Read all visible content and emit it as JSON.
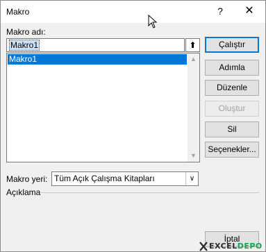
{
  "window": {
    "title": "Makro",
    "help_label": "?",
    "close_label": "✕"
  },
  "form": {
    "macro_name_label": "Makro adı:",
    "macro_name_value": "Makro1",
    "ref_button_label": "⬆",
    "macros": [
      {
        "name": "Makro1",
        "selected": true
      }
    ],
    "macros_in_label": "Makro yeri:",
    "macros_in_value": "Tüm Açık Çalışma Kitapları",
    "description_label": "Açıklama"
  },
  "buttons": {
    "run": "Çalıştır",
    "step_into": "Adımla",
    "edit": "Düzenle",
    "create": "Oluştur",
    "delete": "Sil",
    "options": "Seçenekler...",
    "cancel": "İptal"
  },
  "watermark": {
    "text": "EXCEL",
    "text2": "DEPO"
  },
  "colors": {
    "accent": "#0078d7",
    "selection": "#0078d7"
  }
}
